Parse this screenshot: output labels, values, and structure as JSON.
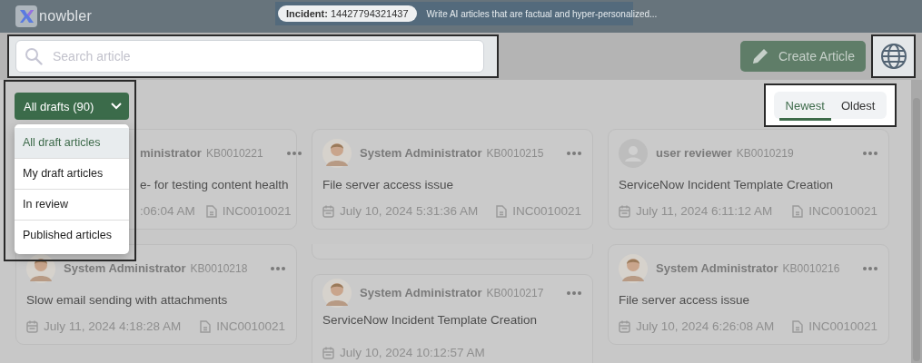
{
  "header": {
    "logo_text": "nowbler",
    "incident": "**Incident:** 14427794321437",
    "banner_text": "Write AI articles that are factual and hyper-personalized..."
  },
  "search": {
    "placeholder": "Search article"
  },
  "create_button": {
    "label": "Create Article"
  },
  "filter": {
    "label": "All drafts (90)",
    "expanded": true,
    "options": [
      {
        "label": "All draft articles",
        "selected": true
      },
      {
        "label": "My draft articles",
        "selected": false
      },
      {
        "label": "In review",
        "selected": false
      },
      {
        "label": "Published articles",
        "selected": false
      }
    ]
  },
  "sort": [
    {
      "label": "Newest",
      "selected": true
    },
    {
      "label": "Oldest",
      "selected": false
    }
  ],
  "columns": [
    {
      "cards": [
        {
          "kind": "partial",
          "author": "ministrator",
          "kb": "KB0010221",
          "title": "e- for testing content health",
          "date": ":06:04 AM",
          "incident": "INC0010021"
        },
        {
          "kind": "card",
          "photo_avatar": true,
          "author": "System Administrator",
          "kb": "KB0010218",
          "title": "Slow email sending with attachments",
          "date": "July 11, 2024 4:18:28 AM",
          "incident": "INC0010021"
        }
      ]
    },
    {
      "cards": [
        {
          "kind": "card",
          "photo_avatar": true,
          "author": "System Administrator",
          "kb": "KB0010215",
          "title": "File server access issue",
          "date": "July 10, 2024 5:31:36 AM",
          "incident": "INC0010021"
        },
        {
          "kind": "edge"
        },
        {
          "kind": "card",
          "photo_avatar": true,
          "author": "System Administrator",
          "kb": "KB0010217",
          "title": "ServiceNow Incident Template Creation",
          "date": "July 10, 2024 10:12:57 AM"
        }
      ]
    },
    {
      "cards": [
        {
          "kind": "card",
          "photo_avatar": false,
          "author": "user reviewer",
          "kb": "KB0010219",
          "title": "ServiceNow Incident Template Creation",
          "date": "July 11, 2024 6:11:12 AM",
          "incident": "INC0010021"
        },
        {
          "kind": "card",
          "photo_avatar": true,
          "author": "System Administrator",
          "kb": "KB0010216",
          "title": "File server access issue",
          "date": "July 10, 2024 6:26:08 AM",
          "incident": "INC0010021"
        }
      ]
    }
  ]
}
